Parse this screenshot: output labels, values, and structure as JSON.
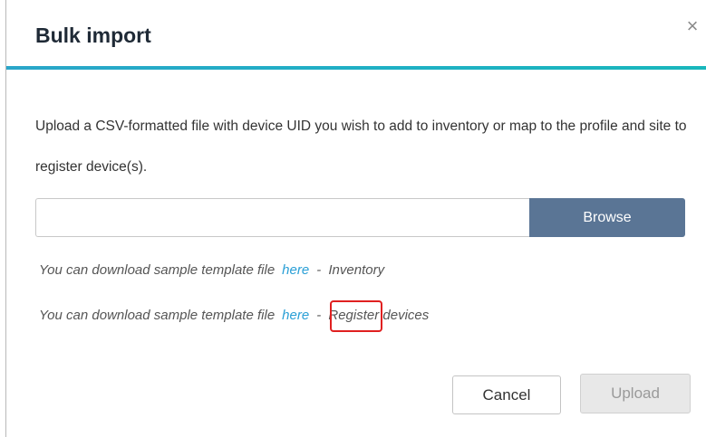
{
  "dialog": {
    "title": "Bulk import",
    "close_glyph": "×",
    "description": "Upload a CSV-formatted file with device UID you wish to add to inventory or map to the profile and site to register device(s).",
    "file_input": {
      "value": "",
      "placeholder": ""
    },
    "browse_label": "Browse",
    "templates": [
      {
        "prefix": "You can download sample template file",
        "link": "here",
        "separator": "-",
        "suffix": "Inventory"
      },
      {
        "prefix": "You can download sample template file",
        "link": "here",
        "separator": "-",
        "suffix": "Register devices"
      }
    ],
    "cancel_label": "Cancel",
    "upload_label": "Upload"
  },
  "colors": {
    "accent_rule": "#1fb0c4",
    "browse_bg": "#5a7595",
    "link": "#2a9fd6",
    "highlight": "#e02020"
  }
}
